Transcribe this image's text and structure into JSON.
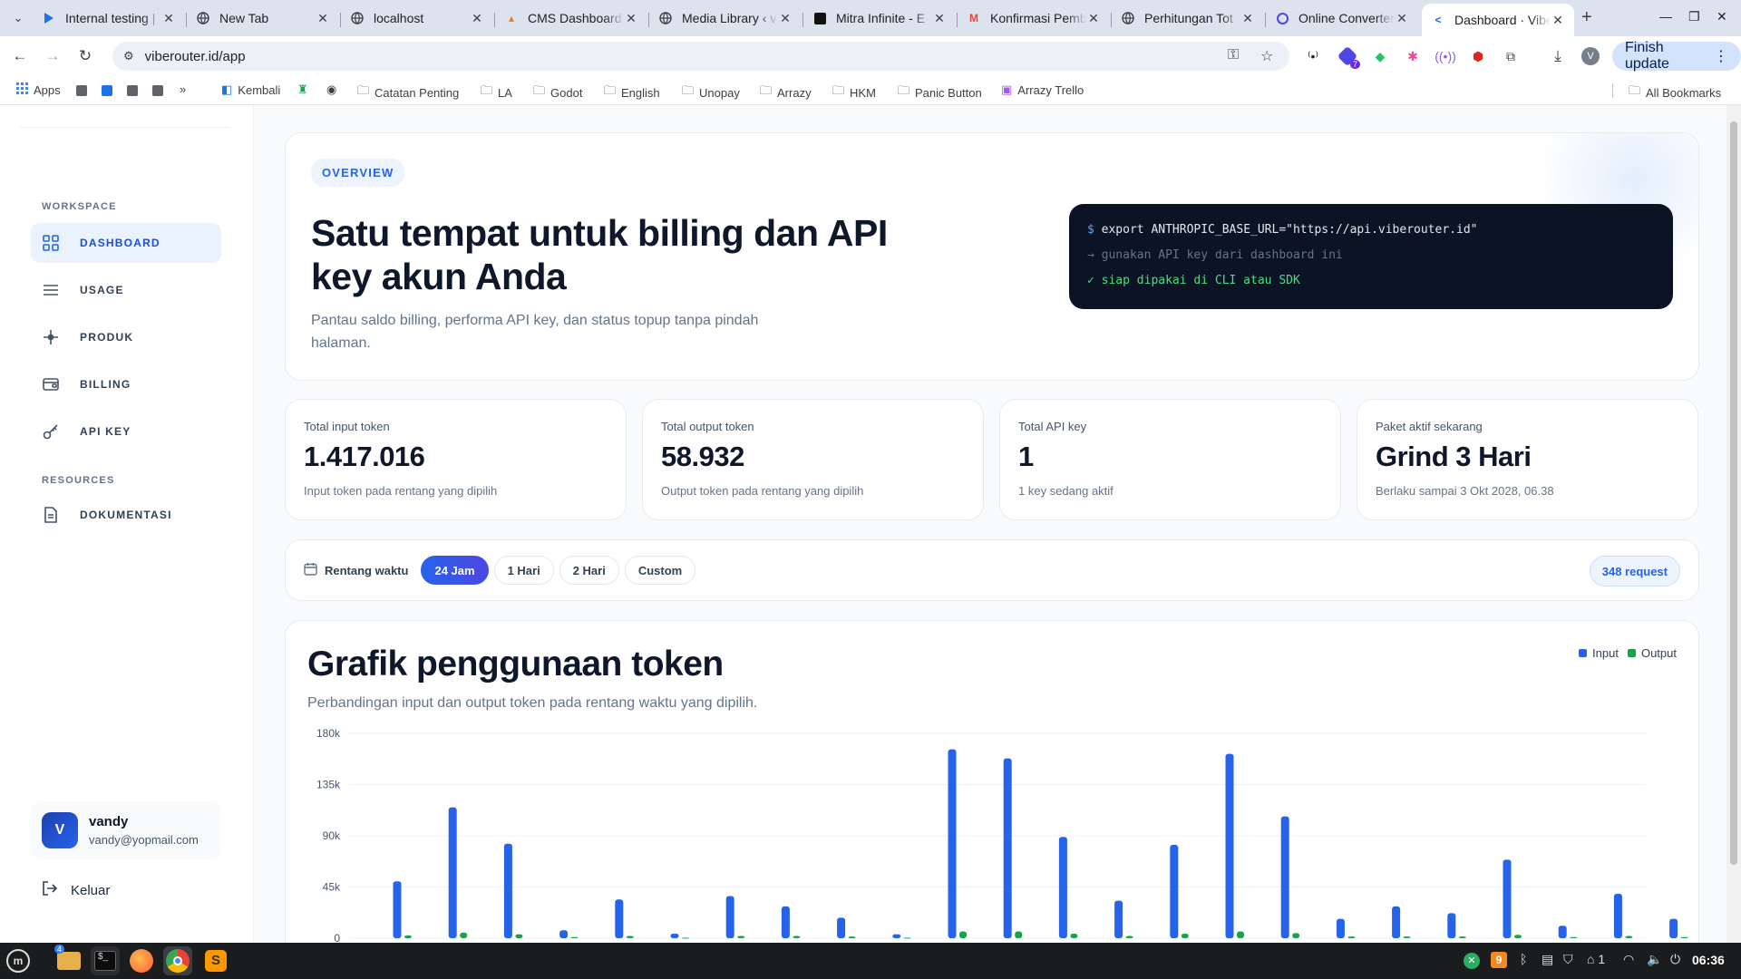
{
  "browser": {
    "tabs": [
      {
        "title": "Internal testing |"
      },
      {
        "title": "New Tab"
      },
      {
        "title": "localhost"
      },
      {
        "title": "CMS Dashboard"
      },
      {
        "title": "Media Library ‹ v"
      },
      {
        "title": "Mitra Infinite - E"
      },
      {
        "title": "Konfirmasi Pemb"
      },
      {
        "title": "Perhitungan Tot"
      },
      {
        "title": "Online Converter"
      },
      {
        "title": "Dashboard · Vibe"
      }
    ],
    "url": "viberouter.id/app",
    "profile_initial": "V",
    "finish_update": "Finish update",
    "extension_badge": "7",
    "bookmarks": {
      "apps": "Apps",
      "items": [
        "Kembali",
        "Catatan Penting",
        "LA",
        "Godot",
        "English",
        "Unopay",
        "Arrazy",
        "HKM",
        "Panic Button",
        "Arrazy Trello"
      ],
      "all": "All Bookmarks"
    }
  },
  "sidebar": {
    "group_workspace": "WORKSPACE",
    "group_resources": "RESOURCES",
    "items": [
      {
        "label": "DASHBOARD"
      },
      {
        "label": "USAGE"
      },
      {
        "label": "PRODUK"
      },
      {
        "label": "BILLING"
      },
      {
        "label": "API KEY"
      },
      {
        "label": "DOKUMENTASI"
      }
    ],
    "user": {
      "initial": "V",
      "name": "vandy",
      "email": "vandy@yopmail.com"
    },
    "logout": "Keluar"
  },
  "hero": {
    "badge": "OVERVIEW",
    "title": "Satu tempat untuk billing dan API key akun Anda",
    "subtitle": "Pantau saldo billing, performa API key, dan status topup tanpa pindah halaman.",
    "terminal": {
      "prompt": "$",
      "line1": "export ANTHROPIC_BASE_URL=\"https://api.viberouter.id\"",
      "line2": "→ gunakan API key dari dashboard ini",
      "line3": "✓ siap dipakai di CLI atau SDK"
    }
  },
  "stats": [
    {
      "label": "Total input token",
      "value": "1.417.016",
      "note": "Input token pada rentang yang dipilih"
    },
    {
      "label": "Total output token",
      "value": "58.932",
      "note": "Output token pada rentang yang dipilih"
    },
    {
      "label": "Total API key",
      "value": "1",
      "note": "1 key sedang aktif"
    },
    {
      "label": "Paket aktif sekarang",
      "value": "Grind 3 Hari",
      "note": "Berlaku sampai 3 Okt 2028, 06.38"
    }
  ],
  "range": {
    "label": "Rentang waktu",
    "options": [
      "24 Jam",
      "1 Hari",
      "2 Hari",
      "Custom"
    ],
    "selected": "24 Jam",
    "requests": "348 request"
  },
  "chart": {
    "title": "Grafik penggunaan token",
    "subtitle": "Perbandingan input dan output token pada rentang waktu yang dipilih.",
    "legend_input": "Input",
    "legend_output": "Output"
  },
  "chart_data": {
    "type": "bar",
    "title": "Grafik penggunaan token",
    "xlabel": "",
    "ylabel": "",
    "ylim": [
      0,
      180000
    ],
    "yticks": [
      "0",
      "45k",
      "90k",
      "135k",
      "180k"
    ],
    "grid": true,
    "legend": "top-right",
    "colors": {
      "input": "#2563eb",
      "output": "#16a34a"
    },
    "series": [
      {
        "name": "Input",
        "values": [
          50000,
          115000,
          83000,
          7000,
          34000,
          4000,
          37000,
          28000,
          18000,
          3500,
          166000,
          158000,
          89000,
          33000,
          82000,
          162000,
          107000,
          17000,
          28000,
          22000,
          69000,
          11000,
          39000,
          17000
        ]
      },
      {
        "name": "Output",
        "values": [
          2500,
          5000,
          3500,
          1000,
          2000,
          500,
          2000,
          2000,
          1500,
          500,
          6000,
          6000,
          4000,
          2000,
          4000,
          6000,
          4500,
          1500,
          1500,
          1500,
          3000,
          1000,
          2000,
          1000
        ]
      }
    ]
  },
  "taskbar": {
    "clock": "06:36",
    "notif_count": "9",
    "folder_badge": "4",
    "tray_count": "1"
  },
  "theme": {
    "accent": "#2563eb",
    "dark": "#0b1324"
  }
}
